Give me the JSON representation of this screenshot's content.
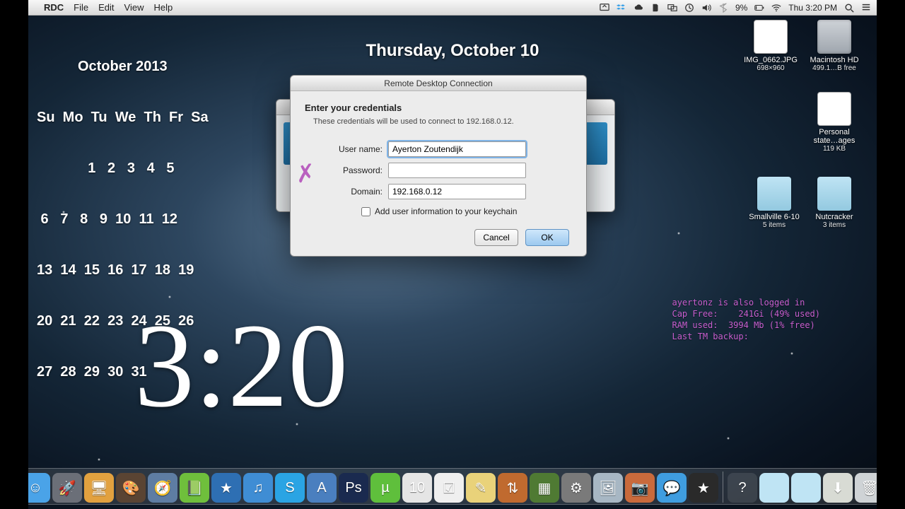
{
  "menubar": {
    "app": "RDC",
    "items": [
      "File",
      "Edit",
      "View",
      "Help"
    ],
    "battery_pct": "9%",
    "clock": "Thu 3:20 PM"
  },
  "date_heading": "Thursday, October 10",
  "calendar": {
    "title": "October 2013",
    "header": "Su  Mo  Tu  We  Th  Fr  Sa",
    "rows": [
      "             1   2   3   4   5",
      " 6   7   8   9  10  11  12",
      "13  14  15  16  17  18  19",
      "20  21  22  23  24  25  26",
      "27  28  29  30  31"
    ]
  },
  "big_clock": "3:20",
  "desktop_icons": [
    {
      "name": "IMG_0662.JPG",
      "sub": "698×960",
      "kind": "img"
    },
    {
      "name": "Macintosh HD",
      "sub": "499.1…B free",
      "kind": "hd"
    },
    {
      "name": "Personal state…ages",
      "sub": "119 KB",
      "kind": "doc"
    },
    {
      "name": "Smallville 6-10",
      "sub": "5 items",
      "kind": "folder"
    },
    {
      "name": "Nutcracker",
      "sub": "3 items",
      "kind": "folder"
    }
  ],
  "status_text": "ayertonz is also logged in\nCap Free:    241Gi (49% used)\nRAM used:  3994 Mb (1% free)\nLast TM backup:",
  "dialog": {
    "title": "Remote Desktop Connection",
    "heading": "Enter your credentials",
    "subtext": "These credentials will be used to connect to 192.168.0.12.",
    "username_label": "User name:",
    "username_value": "Ayerton Zoutendijk",
    "password_label": "Password:",
    "password_value": "",
    "domain_label": "Domain:",
    "domain_value": "192.168.0.12",
    "keychain_label": "Add user information to your keychain",
    "cancel": "Cancel",
    "ok": "OK"
  },
  "dock": [
    {
      "name": "finder",
      "bg": "#4aa3e8",
      "glyph": "☺"
    },
    {
      "name": "launchpad",
      "bg": "#6b6f78",
      "glyph": "🚀"
    },
    {
      "name": "rdc",
      "bg": "#e2a13f",
      "glyph": "🖥"
    },
    {
      "name": "gimp",
      "bg": "#5a4433",
      "glyph": "🎨"
    },
    {
      "name": "safari",
      "bg": "#5e7da3",
      "glyph": "🧭"
    },
    {
      "name": "evernote",
      "bg": "#6fbf3c",
      "glyph": "📗"
    },
    {
      "name": "anki",
      "bg": "#2e6fb3",
      "glyph": "★"
    },
    {
      "name": "itunes",
      "bg": "#3f8dd4",
      "glyph": "♫"
    },
    {
      "name": "skype",
      "bg": "#2aa4e4",
      "glyph": "S"
    },
    {
      "name": "appstore",
      "bg": "#4a7fbf",
      "glyph": "A"
    },
    {
      "name": "photoshop",
      "bg": "#1a2a4f",
      "glyph": "Ps"
    },
    {
      "name": "utorrent",
      "bg": "#5fbf3c",
      "glyph": "µ"
    },
    {
      "name": "ical",
      "bg": "#e5e5e5",
      "glyph": "10"
    },
    {
      "name": "reminders",
      "bg": "#efefef",
      "glyph": "☑"
    },
    {
      "name": "notes",
      "bg": "#e9d27a",
      "glyph": "✎"
    },
    {
      "name": "transmission",
      "bg": "#c06a2f",
      "glyph": "⇅"
    },
    {
      "name": "minecraft",
      "bg": "#4f7a33",
      "glyph": "▦"
    },
    {
      "name": "systemprefs",
      "bg": "#7a7a7a",
      "glyph": "⚙"
    },
    {
      "name": "preview",
      "bg": "#a7b7c4",
      "glyph": "🖼"
    },
    {
      "name": "photobooth",
      "bg": "#c96a3c",
      "glyph": "📷"
    },
    {
      "name": "messages",
      "bg": "#3f9de0",
      "glyph": "💬"
    },
    {
      "name": "imovie",
      "bg": "#2a2a2a",
      "glyph": "★"
    }
  ],
  "dock_right": [
    {
      "name": "help",
      "bg": "rgba(255,255,255,.1)",
      "glyph": "?"
    },
    {
      "name": "applications",
      "bg": "#bfe4f4",
      "glyph": ""
    },
    {
      "name": "documents",
      "bg": "#bfe4f4",
      "glyph": ""
    },
    {
      "name": "downloads",
      "bg": "#d8dbd4",
      "glyph": "⬇"
    },
    {
      "name": "trash",
      "bg": "#cfd3d6",
      "glyph": "🗑"
    }
  ]
}
